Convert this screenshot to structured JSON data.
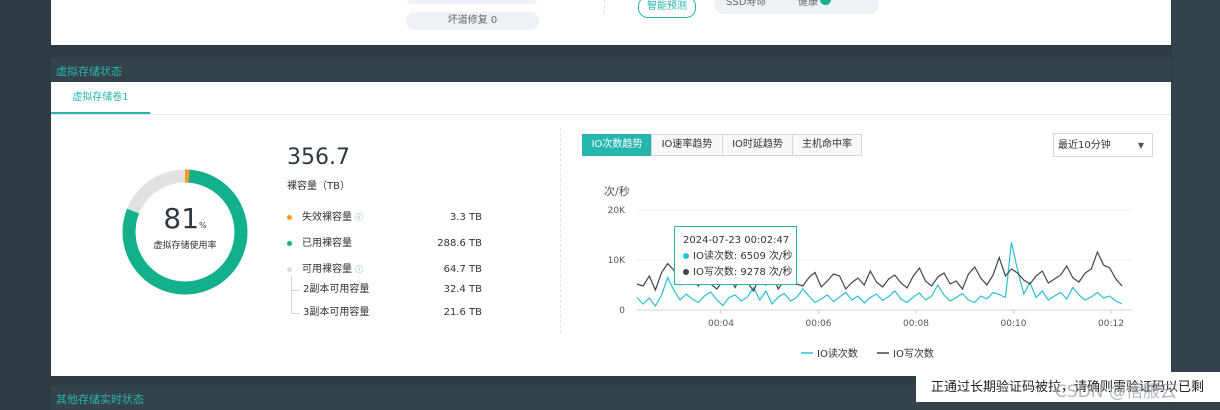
{
  "top": {
    "bad_sector_label": "坏道修复 0",
    "smart_btn": "智能预测",
    "ssd_label": "SSD寿命",
    "ssd_status": "健康"
  },
  "section_title": "虚拟存储状态",
  "tab": "虚拟存储卷1",
  "donut": {
    "percent": 81,
    "percent_text": "81",
    "unit": "%",
    "label": "虚拟存储使用率",
    "used_color": "#13b18b",
    "failed_color": "#f29c1f",
    "remain_color": "#dfe1e3"
  },
  "capacity": {
    "value": "356.7",
    "label": "裸容量（TB）",
    "rows": [
      {
        "label": "失效裸容量",
        "value": "3.3 TB",
        "color": "#f29c1f"
      },
      {
        "label": "已用裸容量",
        "value": "288.6 TB",
        "color": "#13b18b"
      },
      {
        "label": "可用裸容量",
        "value": "64.7 TB",
        "color": "#dcdcdc"
      }
    ],
    "sub_rows": [
      {
        "label": "2副本可用容量",
        "value": "32.4 TB"
      },
      {
        "label": "3副本可用容量",
        "value": "21.6 TB"
      }
    ]
  },
  "buttons": [
    "IO次数趋势",
    "IO速率趋势",
    "IO时延趋势",
    "主机命中率"
  ],
  "select_value": "最近10分钟",
  "tooltip": {
    "time": "2024-07-23 00:02:47",
    "read": "IO读次数: 6509 次/秒",
    "write": "IO写次数: 9278 次/秒"
  },
  "bottom_title": "其他存储实时状态",
  "toast_text": "正通过长期验证码被拉，请确则需验证码以已剩",
  "watermark": "CSDN @悟服云",
  "chart_data": {
    "type": "line",
    "ylabel": "次/秒",
    "ylim": [
      0,
      20000
    ],
    "yticks": [
      "0",
      "10K",
      "20K"
    ],
    "xticks": [
      "00:04",
      "00:06",
      "00:08",
      "00:10",
      "00:12"
    ],
    "legend_position": "bottom-center",
    "series": [
      {
        "name": "IO读次数",
        "color": "#2bbfd4",
        "values": [
          2500,
          1200,
          2400,
          800,
          3000,
          6509,
          4000,
          2000,
          3200,
          2200,
          1500,
          2800,
          3600,
          2000,
          900,
          2500,
          3000,
          1800,
          2600,
          4500,
          2000,
          3800,
          1200,
          2600,
          3300,
          1800,
          2500,
          4200,
          2800,
          1500,
          2200,
          3000,
          1700,
          2600,
          3500,
          2000,
          2800,
          1400,
          2500,
          3200,
          1900,
          2700,
          3800,
          2200,
          1500,
          2600,
          3400,
          2000,
          2800,
          5000,
          3000,
          1800,
          2500,
          3300,
          2000,
          1500,
          2800,
          2200,
          3500,
          3100,
          2500,
          13500,
          8000,
          3200,
          5500,
          2500,
          3800,
          2000,
          2800,
          3500,
          2200,
          4500,
          3000,
          2000,
          2600,
          3500,
          2400,
          2800,
          1800,
          1200
        ]
      },
      {
        "name": "IO写次数",
        "color": "#3d4852",
        "values": [
          5200,
          4800,
          6800,
          4000,
          7500,
          9278,
          8000,
          5200,
          11500,
          6200,
          4800,
          7000,
          5200,
          4200,
          5800,
          6500,
          4500,
          7200,
          5500,
          3800,
          6800,
          5000,
          7600,
          4200,
          6000,
          8200,
          5200,
          4800,
          6500,
          7500,
          4600,
          5800,
          7200,
          6800,
          4200,
          5500,
          6400,
          5000,
          7800,
          5600,
          4600,
          6200,
          7000,
          5400,
          4400,
          6800,
          8400,
          5800,
          4800,
          6600,
          7400,
          5200,
          5800,
          4200,
          7200,
          8600,
          6400,
          5000,
          7000,
          10500,
          6800,
          8200,
          7400,
          6000,
          5200,
          6800,
          7800,
          5400,
          6200,
          7000,
          8800,
          6400,
          5600,
          7400,
          8200,
          11600,
          9000,
          8400,
          6200,
          4800
        ]
      }
    ]
  }
}
